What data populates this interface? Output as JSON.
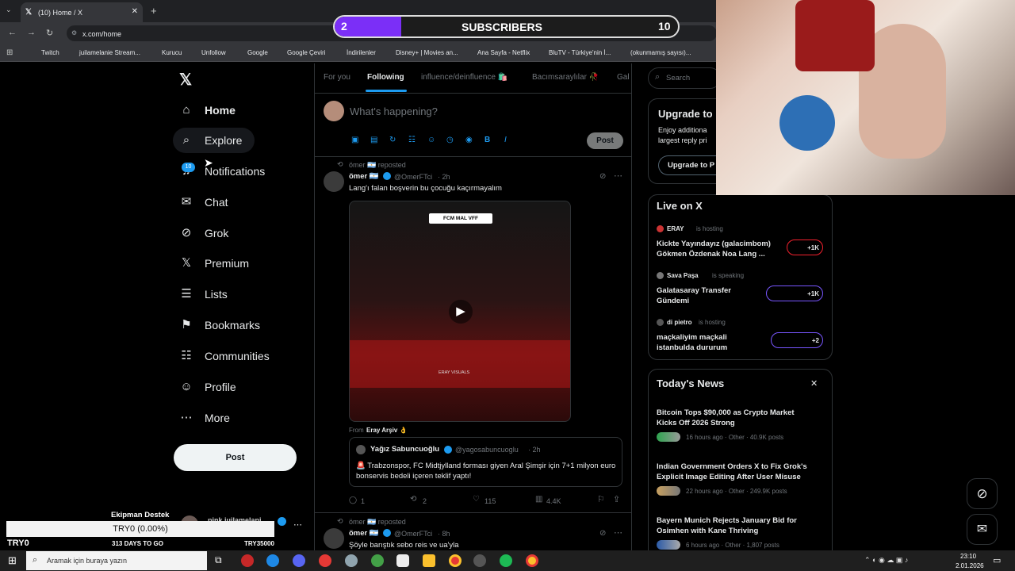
{
  "browser": {
    "tab_title": "(10) Home / X",
    "url": "x.com/home",
    "bookmarks": [
      "Twitch",
      "juilamelanie Stream...",
      "Kurucu",
      "Unfollow",
      "Google",
      "Google Çeviri",
      "İndirilenler",
      "Disney+ | Movies an...",
      "Ana Sayfa - Netflix",
      "BluTV - Türkiye'nin İ...",
      "(okunmamış sayısı)..."
    ]
  },
  "overlay": {
    "subs_left": "2",
    "subs_label": "SUBSCRIBERS",
    "subs_right": "10",
    "ticker_title": "Ekipman Destek",
    "ticker_value": "TRY0 (0.00%)",
    "ticker_left": "TRY0",
    "ticker_days": "313 DAYS TO GO",
    "ticker_goal": "TRY35000"
  },
  "nav": {
    "items": [
      "Home",
      "Explore",
      "Notifications",
      "Chat",
      "Grok",
      "Premium",
      "Lists",
      "Bookmarks",
      "Communities",
      "Profile",
      "More"
    ],
    "notif_badge": "10",
    "post_label": "Post",
    "account_partial": "pink juilamelani"
  },
  "feed": {
    "tabs": [
      "For you",
      "Following",
      "influence/deinfluence 🛍️",
      "Bacımsaraylılar 🥀",
      "Gala"
    ],
    "compose_placeholder": "What's happening?",
    "compose_post": "Post",
    "post1": {
      "repost": "ömer 🇦🇷 reposted",
      "name": "ömer 🇦🇷",
      "handle": "@OmerFTci",
      "time": "· 2h",
      "text": "Lang'ı falan boşverin bu çocuğu kaçırmayalım",
      "video_banner": "FCM  MAL  VFF",
      "video_watermark": "ERAY VISUALS",
      "from_label": "From",
      "from_name": "Eray Arşiv 👌",
      "quote_name": "Yağız Sabuncuoğlu",
      "quote_handle": "@yagosabuncuoglu",
      "quote_time": "· 2h",
      "quote_text": "🚨 Trabzonspor, FC Midtjylland forması giyen Aral Şimşir için 7+1 milyon euro bonservis bedeli içeren teklif yaptı!",
      "replies": "1",
      "reposts": "2",
      "likes": "115",
      "views": "4.4K"
    },
    "post2": {
      "repost": "ömer 🇦🇷 reposted",
      "name": "ömer 🇦🇷",
      "handle": "@OmerFTci",
      "time": "· 8h",
      "text": "Şöyle barıştık sebo reis ve ua'yla"
    }
  },
  "right": {
    "search_placeholder": "Search",
    "upgrade_title": "Upgrade to",
    "upgrade_text1": "Enjoy additiona",
    "upgrade_text2": "largest reply pri",
    "upgrade_btn": "Upgrade to P",
    "live_title": "Live on X",
    "live": [
      {
        "host": "ERAY",
        "status": "is hosting",
        "title1": "Kickte Yayındayız (galacimbom)",
        "title2": "Gökmen Özdenak Noa Lang ...",
        "count": "+1K"
      },
      {
        "host": "Sava Paşa",
        "status": "is speaking",
        "title1": "Galatasaray Transfer",
        "title2": "Gündemi",
        "count": "+1K"
      },
      {
        "host": "di pietro",
        "status": "is hosting",
        "title1": "maçkaliyim maçkali",
        "title2": "istanbulda dururum",
        "count": "+2"
      }
    ],
    "news_title": "Today's News",
    "news": [
      {
        "title1": "Bitcoin Tops $90,000 as Crypto Market",
        "title2": "Kicks Off 2026 Strong",
        "meta": "16 hours ago · Other · 40.9K posts"
      },
      {
        "title1": "Indian Government Orders X to Fix Grok's",
        "title2": "Explicit Image Editing After User Misuse",
        "meta": "22 hours ago · Other · 249.9K posts"
      },
      {
        "title1": "Bayern Munich Rejects January Bid for",
        "title2": "Osimhen with Kane Thriving",
        "meta": "6 hours ago · Other · 1,807 posts"
      }
    ]
  },
  "taskbar": {
    "search_placeholder": "Aramak için buraya yazın",
    "time": "23:10",
    "date": "2.01.2026"
  }
}
